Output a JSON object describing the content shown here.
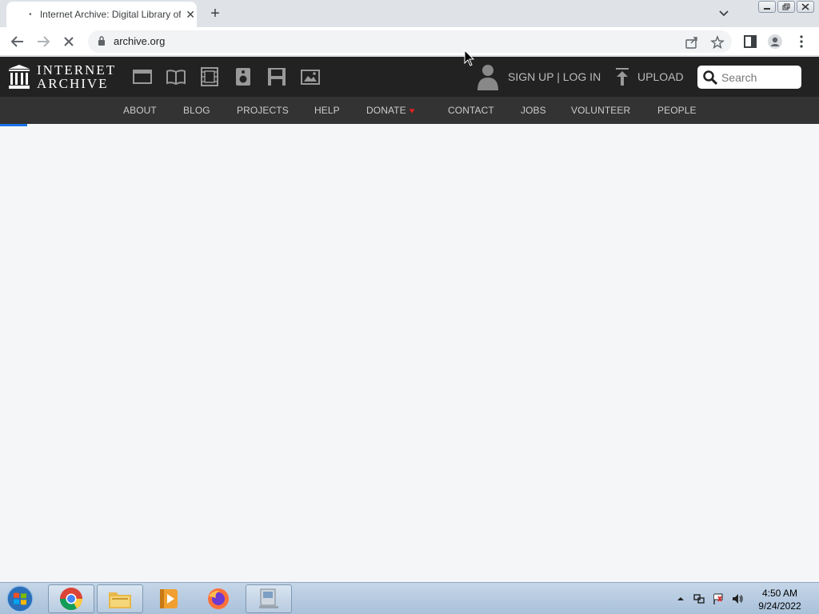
{
  "browser": {
    "tab_title": "Internet Archive: Digital Library of Free & Borrowable Books, Movies, Music & Wayback Machine",
    "tab_close": "✕",
    "new_tab": "+",
    "url": "archive.org"
  },
  "site": {
    "logo_line1": "INTERNET",
    "logo_line2": "ARCHIVE",
    "media_icons": [
      "web-icon",
      "texts-icon",
      "video-icon",
      "audio-icon",
      "software-icon",
      "images-icon"
    ],
    "signup_login": "SIGN UP | LOG IN",
    "upload": "UPLOAD",
    "search_placeholder": "Search",
    "nav": {
      "about": "ABOUT",
      "blog": "BLOG",
      "projects": "PROJECTS",
      "help": "HELP",
      "donate": "DONATE",
      "contact": "CONTACT",
      "jobs": "JOBS",
      "volunteer": "VOLUNTEER",
      "people": "PEOPLE"
    }
  },
  "taskbar": {
    "apps": [
      "chrome-icon",
      "file-explorer-icon",
      "media-player-icon",
      "firefox-icon",
      "computer-icon"
    ],
    "time": "4:50 AM",
    "date": "9/24/2022"
  },
  "colors": {
    "ia_header": "#222222",
    "ia_nav": "#333333",
    "content_bg": "#f5f6f8",
    "load_bar": "#1a73e8",
    "donate_heart": "#e02020"
  }
}
